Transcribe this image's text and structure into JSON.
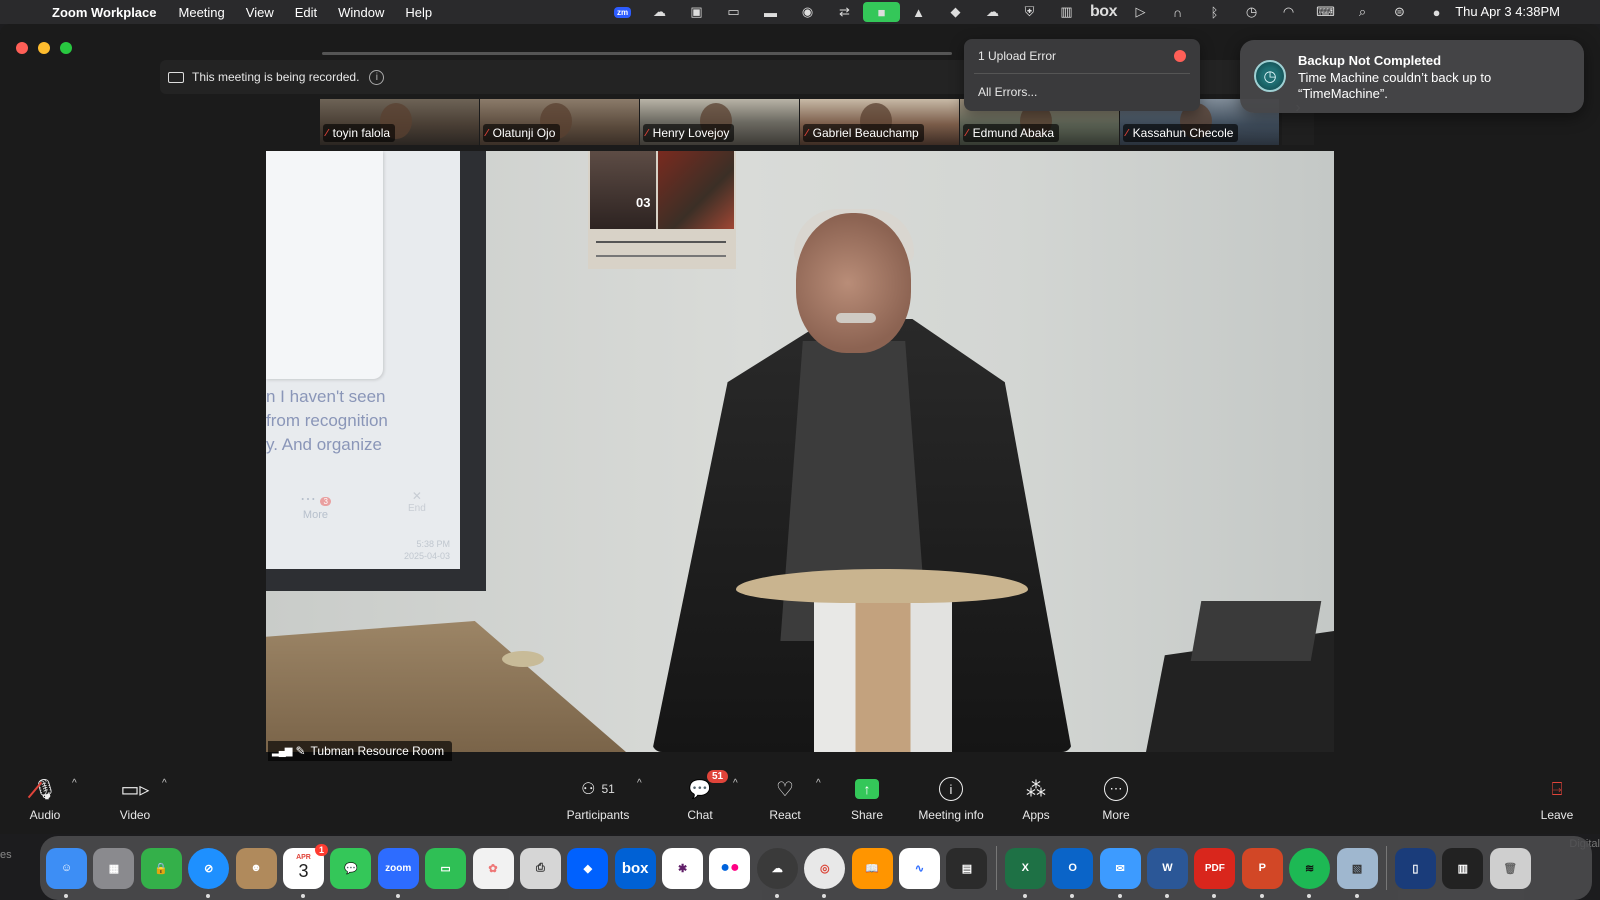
{
  "menubar": {
    "app_name": "Zoom Workplace",
    "menus": [
      "Meeting",
      "View",
      "Edit",
      "Window",
      "Help"
    ],
    "status_icons": [
      "zoom-icon",
      "creative-cloud-icon",
      "outlook-icon",
      "folder-icon",
      "screen-record-icon",
      "grammarly-icon",
      "sync-icon",
      "facetime-icon",
      "drive-icon",
      "dropbox-icon",
      "cloud-error-icon",
      "shield-icon",
      "layout-icon",
      "box-icon",
      "play-icon",
      "headphones-icon",
      "bluetooth-icon",
      "time-machine-icon",
      "wifi-icon",
      "keyboard-icon",
      "spotlight-icon",
      "control-center-icon",
      "siri-icon"
    ],
    "box_label": "box",
    "zoom_badge": "zm",
    "clock": "Thu Apr 3  4:38PM"
  },
  "recording": {
    "text": "This meeting is being recorded."
  },
  "participants": [
    {
      "name": "toyin falola"
    },
    {
      "name": "Olatunji Ojo"
    },
    {
      "name": "Henry Lovejoy"
    },
    {
      "name": "Gabriel Beauchamp"
    },
    {
      "name": "Edmund Abaka"
    },
    {
      "name": "Kassahun Checole"
    }
  ],
  "main_video": {
    "room_label": "Tubman Resource Room",
    "slide_lines": [
      "n I haven't seen",
      "from recognition",
      "y. And organize"
    ],
    "slide_more": "More",
    "slide_end": "End",
    "slide_time": "5:38 PM",
    "slide_date": "2025-04-03",
    "slide_badge": "3",
    "poster_date": "03"
  },
  "toolbar": {
    "audio": "Audio",
    "video": "Video",
    "participants": "Participants",
    "participants_count": "51",
    "chat": "Chat",
    "chat_badge": "51",
    "react": "React",
    "share": "Share",
    "meeting_info": "Meeting info",
    "apps": "Apps",
    "more": "More",
    "leave": "Leave"
  },
  "upload_popup": {
    "error": "1 Upload Error",
    "all_errors": "All Errors..."
  },
  "notification": {
    "title": "Backup Not Completed",
    "body": "Time Machine couldn’t back up to “TimeMachine”."
  },
  "dock": {
    "edge_left": "es",
    "edge_right": "Digital",
    "calendar_month": "APR",
    "calendar_day": "3",
    "calendar_badge": "1",
    "apps": [
      {
        "name": "finder",
        "color": "#3d8ef5"
      },
      {
        "name": "launchpad",
        "color": "#8a8a8e"
      },
      {
        "name": "lock",
        "color": "#34b04a"
      },
      {
        "name": "safari",
        "color": "#1e90ff"
      },
      {
        "name": "contacts",
        "color": "#b08a5c"
      },
      {
        "name": "calendar",
        "color": "#ffffff"
      },
      {
        "name": "messages",
        "color": "#34c759"
      },
      {
        "name": "zoom",
        "color": "#2d6cff",
        "label": "zoom"
      },
      {
        "name": "facetime",
        "color": "#2fbf55"
      },
      {
        "name": "photos",
        "color": "#f2f2f2"
      },
      {
        "name": "printer",
        "color": "#d6d6d6"
      },
      {
        "name": "dropbox",
        "color": "#0061fe"
      },
      {
        "name": "box",
        "color": "#0061d5",
        "label": "box"
      },
      {
        "name": "slack",
        "color": "#ffffff"
      },
      {
        "name": "flickr",
        "color": "#ffffff"
      },
      {
        "name": "creative-cloud",
        "color": "#3a3a3a"
      },
      {
        "name": "chrome",
        "color": "#e8e8e8"
      },
      {
        "name": "books",
        "color": "#ff9500"
      },
      {
        "name": "freeform",
        "color": "#ffffff"
      },
      {
        "name": "archive",
        "color": "#2b2b2b"
      },
      {
        "name": "excel",
        "color": "#1e7145"
      },
      {
        "name": "outlook",
        "color": "#0a64c8"
      },
      {
        "name": "mail",
        "color": "#3d9bff"
      },
      {
        "name": "word",
        "color": "#2b5797"
      },
      {
        "name": "pdf",
        "color": "#d9261c",
        "label": "PDF"
      },
      {
        "name": "powerpoint",
        "color": "#d24726"
      },
      {
        "name": "spotify",
        "color": "#1db954"
      },
      {
        "name": "preview",
        "color": "#9fb7cf"
      },
      {
        "name": "remote",
        "color": "#1a3c7a"
      },
      {
        "name": "activity-monitor",
        "color": "#222222"
      },
      {
        "name": "trash",
        "color": "#cfcfcf"
      }
    ]
  }
}
